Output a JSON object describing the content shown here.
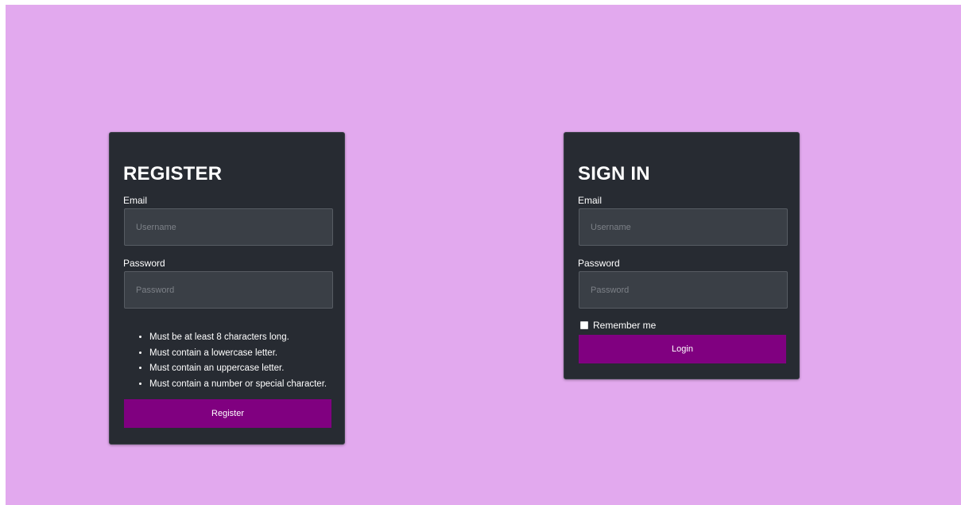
{
  "register": {
    "title": "REGISTER",
    "email_label": "Email",
    "email_placeholder": "Username",
    "password_label": "Password",
    "password_placeholder": "Password",
    "rules": [
      "Must be at least 8 characters long.",
      "Must contain a lowercase letter.",
      "Must contain an uppercase letter.",
      "Must contain a number or special character."
    ],
    "button_label": "Register"
  },
  "signin": {
    "title": "SIGN IN",
    "email_label": "Email",
    "email_placeholder": "Username",
    "password_label": "Password",
    "password_placeholder": "Password",
    "remember_label": "Remember me",
    "remember_checked": false,
    "button_label": "Login"
  },
  "colors": {
    "background": "#e2a9ee",
    "card": "#272b32",
    "input": "#3a3f46",
    "button": "#800080"
  }
}
